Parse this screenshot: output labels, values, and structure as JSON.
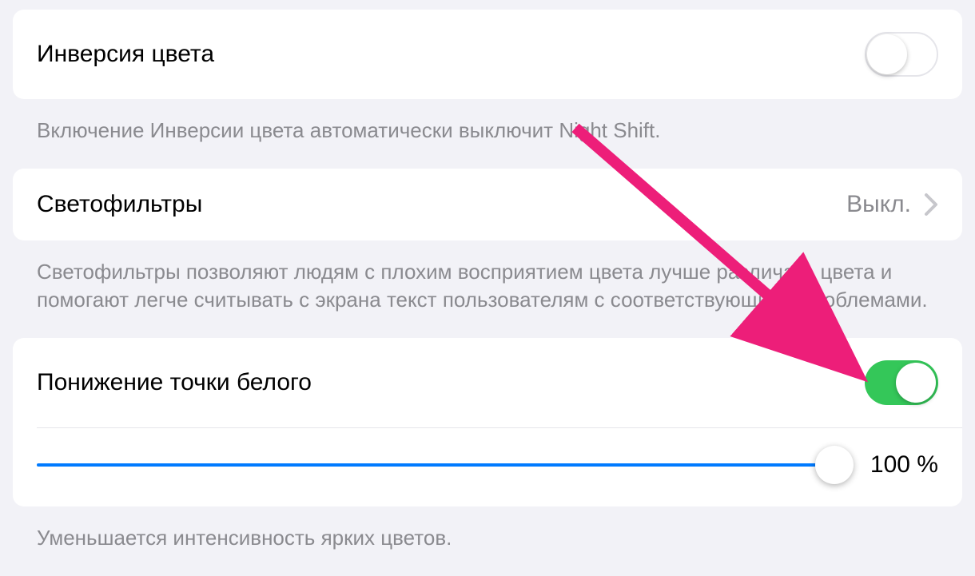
{
  "invert_colors": {
    "label": "Инверсия цвета",
    "enabled": false,
    "footer": "Включение Инверсии цвета автоматически выключит Night Shift."
  },
  "color_filters": {
    "label": "Светофильтры",
    "value": "Выкл.",
    "footer": "Светофильтры позволяют людям с плохим восприятием цвета лучше различать цвета и помогают легче считывать с экрана текст пользователям с соответствующими проблемами."
  },
  "reduce_white_point": {
    "label": "Понижение точки белого",
    "enabled": true,
    "slider_value": 100,
    "slider_display": "100 %",
    "footer": "Уменьшается интенсивность ярких цветов."
  }
}
